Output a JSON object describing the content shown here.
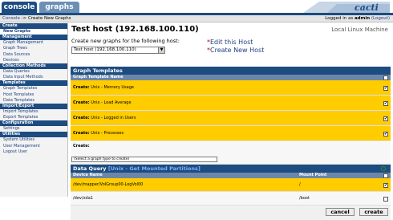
{
  "tabs": [
    {
      "label": "console"
    },
    {
      "label": "graphs"
    }
  ],
  "logo": {
    "text": "cacti"
  },
  "breadcrumb": {
    "root": "Console",
    "separator": "->",
    "current": "Create New Graphs"
  },
  "login": {
    "prefix": "Logged in as",
    "user": "admin",
    "logout": "(Logout)"
  },
  "sidebar": {
    "sections": [
      {
        "header": "Create",
        "items": [
          "New Graphs"
        ]
      },
      {
        "header": "Management",
        "items": [
          "Graph Management",
          "Graph Trees",
          "Data Sources",
          "Devices"
        ]
      },
      {
        "header": "Collection Methods",
        "items": [
          "Data Queries",
          "Data Input Methods"
        ]
      },
      {
        "header": "Templates",
        "items": [
          "Graph Templates",
          "Host Templates",
          "Data Templates"
        ]
      },
      {
        "header": "Import/Export",
        "items": [
          "Import Templates",
          "Export Templates"
        ]
      },
      {
        "header": "Configuration",
        "items": [
          "Settings"
        ]
      },
      {
        "header": "Utilities",
        "items": [
          "System Utilities",
          "User Management",
          "Logout User"
        ]
      }
    ]
  },
  "host": {
    "title": "Test host (192.168.100.110)",
    "template": "Local Linux Machine",
    "prompt": "Create new graphs for the following host:",
    "select_value": "Test host (192.168.100.110)",
    "edit_link": "Edit this Host",
    "new_link": "Create New Host"
  },
  "graph_templates": {
    "header": "Graph Templates",
    "column": "Graph Template Name",
    "rows": [
      {
        "prefix": "Create:",
        "name": "Unix - Memory Usage",
        "checked": "✔"
      },
      {
        "prefix": "Create:",
        "name": "Unix - Load Average",
        "checked": "✔"
      },
      {
        "prefix": "Create:",
        "name": "Unix - Logged in Users",
        "checked": "✔"
      },
      {
        "prefix": "Create:",
        "name": "Unix - Processes",
        "checked": "✔"
      }
    ],
    "create_label": "Create:",
    "create_select": "(Select a graph type to create)"
  },
  "data_query": {
    "header_prefix": "Data Query",
    "header_sub": "[Unix - Get Mounted Partitions]",
    "col_device": "Device Name",
    "col_mount": "Mount Point",
    "rows": [
      {
        "device": "/dev/mapper/VolGroup00-LogVol00",
        "mount": "/",
        "checked": "✔"
      },
      {
        "device": "/dev/xda1",
        "mount": "/boot",
        "checked": ""
      }
    ]
  },
  "buttons": {
    "cancel": "cancel",
    "create": "create"
  },
  "colors": {
    "brand_blue": "#1d4c80",
    "highlight": "#ffcc00"
  }
}
